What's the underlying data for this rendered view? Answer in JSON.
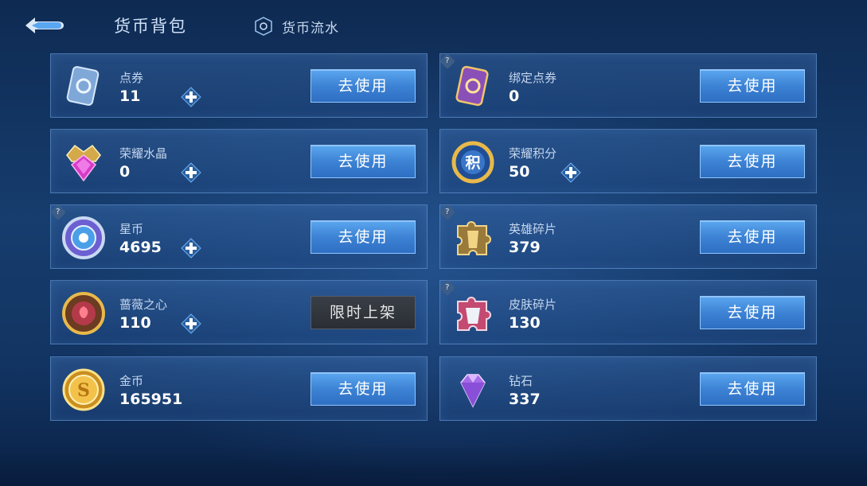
{
  "header": {
    "title": "货币背包",
    "history_tab": "货币流水"
  },
  "cards": [
    {
      "name": "点券",
      "amount": "11",
      "button": "去使用",
      "has_plus": true,
      "has_info": false,
      "icon": "coupon-icon"
    },
    {
      "name": "绑定点券",
      "amount": "0",
      "button": "去使用",
      "has_plus": false,
      "has_info": true,
      "icon": "bound-coupon-icon"
    },
    {
      "name": "荣耀水晶",
      "amount": "0",
      "button": "去使用",
      "has_plus": true,
      "has_info": false,
      "icon": "glory-crystal-icon"
    },
    {
      "name": "荣耀积分",
      "amount": "50",
      "button": "去使用",
      "has_plus": true,
      "has_info": false,
      "icon": "glory-points-icon"
    },
    {
      "name": "星币",
      "amount": "4695",
      "button": "去使用",
      "has_plus": true,
      "has_info": true,
      "icon": "star-coin-icon"
    },
    {
      "name": "英雄碎片",
      "amount": "379",
      "button": "去使用",
      "has_plus": false,
      "has_info": true,
      "icon": "hero-fragment-icon"
    },
    {
      "name": "蔷薇之心",
      "amount": "110",
      "button": "限时上架",
      "has_plus": true,
      "has_info": false,
      "icon": "rose-heart-icon",
      "disabled": true
    },
    {
      "name": "皮肤碎片",
      "amount": "130",
      "button": "去使用",
      "has_plus": false,
      "has_info": true,
      "icon": "skin-fragment-icon"
    },
    {
      "name": "金币",
      "amount": "165951",
      "button": "去使用",
      "has_plus": false,
      "has_info": false,
      "icon": "gold-coin-icon"
    },
    {
      "name": "钻石",
      "amount": "337",
      "button": "去使用",
      "has_plus": false,
      "has_info": false,
      "icon": "diamond-icon"
    }
  ],
  "colors": {
    "accent": "#3d83d4",
    "card_border": "#6ea0dc",
    "background": "#163d6e"
  }
}
